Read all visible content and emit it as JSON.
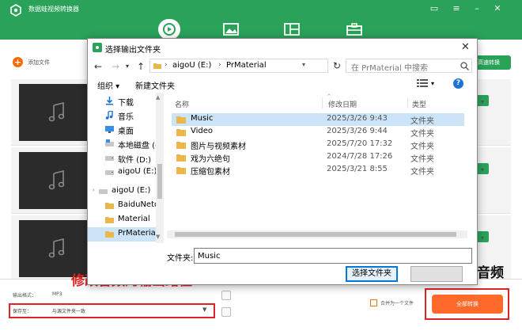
{
  "app": {
    "title": "数据蛙视频转换器",
    "nav_icons": [
      "video-convert-icon",
      "image-icon",
      "layout-icon",
      "toolbox-icon"
    ],
    "window_controls": [
      "chat-icon",
      "menu-icon",
      "minimize-icon",
      "close-icon"
    ],
    "colors": {
      "brand": "#2aa25a",
      "accent": "#ff6a2b",
      "annotation": "#e32323",
      "selection": "#cce4f7"
    }
  },
  "toolbar": {
    "add_file_label": "添加文件",
    "fast_convert_label": "高速转换"
  },
  "bottom": {
    "output_format_label": "输出格式：",
    "output_format_value": "MP3",
    "save_to_label": "保存至：",
    "save_to_value": "与源文件夹一致",
    "merge_label": "合并为一个文件",
    "convert_all_label": "全部转换"
  },
  "annotations": {
    "left": "修改音频的输出路径",
    "right": "开始转换音频"
  },
  "dialog": {
    "title": "选择输出文件夹",
    "address": [
      "aigoU (E:)",
      "PrMaterial"
    ],
    "search_placeholder": "在 PrMaterial 中搜索",
    "organize_label": "组织 ▾",
    "new_folder_label": "新建文件夹",
    "nav_items": [
      {
        "label": "下载",
        "icon": "download-icon"
      },
      {
        "label": "音乐",
        "icon": "music-note-icon"
      },
      {
        "label": "桌面",
        "icon": "desktop-icon"
      },
      {
        "label": "本地磁盘 (C",
        "icon": "drive-icon"
      },
      {
        "label": "软件 (D:)",
        "icon": "drive-icon"
      },
      {
        "label": "aigoU (E:)",
        "icon": "usb-drive-icon"
      },
      {
        "label": "aigoU (E:)",
        "icon": "usb-drive-icon"
      },
      {
        "label": "BaiduNetd",
        "icon": "folder-icon"
      },
      {
        "label": "Material",
        "icon": "folder-icon"
      },
      {
        "label": "PrMaterial",
        "icon": "folder-icon"
      }
    ],
    "columns": {
      "name": "名称",
      "modified": "修改日期",
      "type": "类型"
    },
    "files": [
      {
        "name": "Music",
        "date": "2025/3/26 9:43",
        "type": "文件夹"
      },
      {
        "name": "Video",
        "date": "2025/3/26 9:44",
        "type": "文件夹"
      },
      {
        "name": "图片与视频素材",
        "date": "2025/7/20 17:32",
        "type": "文件夹"
      },
      {
        "name": "戏为六绝句",
        "date": "2024/7/28 17:26",
        "type": "文件夹"
      },
      {
        "name": "压缩包素材",
        "date": "2025/3/21 8:55",
        "type": "文件夹"
      }
    ],
    "folder_label": "文件夹:",
    "folder_value": "Music",
    "select_folder_label": "选择文件夹"
  }
}
